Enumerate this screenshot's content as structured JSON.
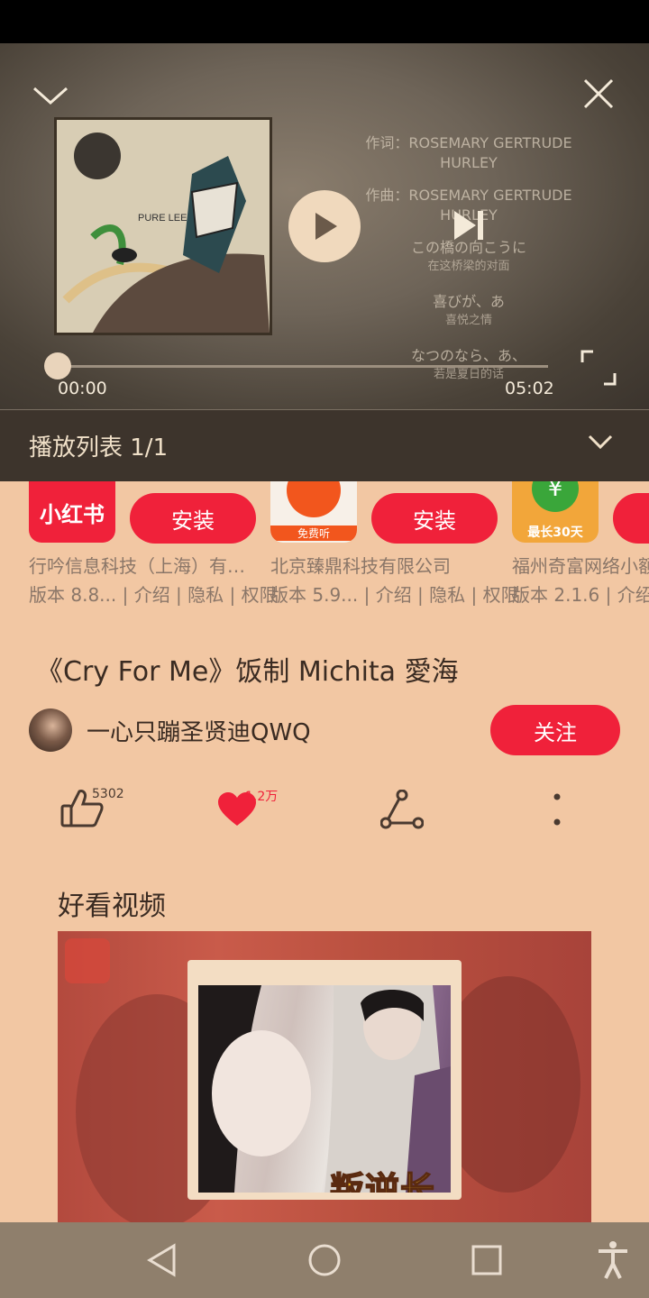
{
  "player": {
    "lyrics": [
      {
        "line": "作词：ROSEMARY GERTRUDE",
        "sub": "HURLEY"
      },
      {
        "line": "作曲：ROSEMARY GERTRUDE",
        "sub": "HURLEY"
      },
      {
        "line": "この橋の向こうに",
        "sub": "在这桥梁的对面"
      },
      {
        "line": "喜びが、あ",
        "sub": "喜悦之情"
      },
      {
        "line": "なつのなら、あ、",
        "sub": "若是夏日的话"
      }
    ],
    "album_text": "PURE LEE",
    "time_current": "00:00",
    "time_total": "05:02",
    "progress_fraction": 0.0
  },
  "playlist": {
    "label": "播放列表 1/1"
  },
  "apps": [
    {
      "icon_text": "小红书",
      "install_label": "安装",
      "company": "行吟信息科技（上海）有…",
      "version": "版本 8.8...",
      "links": [
        "介绍",
        "隐私",
        "权限"
      ]
    },
    {
      "icon_text": "免费听",
      "install_label": "安装",
      "company": "北京臻鼎科技有限公司",
      "version": "版本 5.9...",
      "links": [
        "介绍",
        "隐私",
        "权限"
      ]
    },
    {
      "icon_text": "最长30天",
      "install_label": "",
      "company": "福州奇富网络小额",
      "version": "版本 2.1.6",
      "links": [
        "介绍"
      ]
    }
  ],
  "video": {
    "title": "《Cry For Me》饭制 Michita 愛海",
    "author": "一心只蹦圣贤迪QWQ",
    "follow_label": "关注",
    "likes": "5302",
    "favorites": "1.2万"
  },
  "section": {
    "title": "好看视频"
  },
  "recommend": {
    "caption": "叛逆长"
  }
}
